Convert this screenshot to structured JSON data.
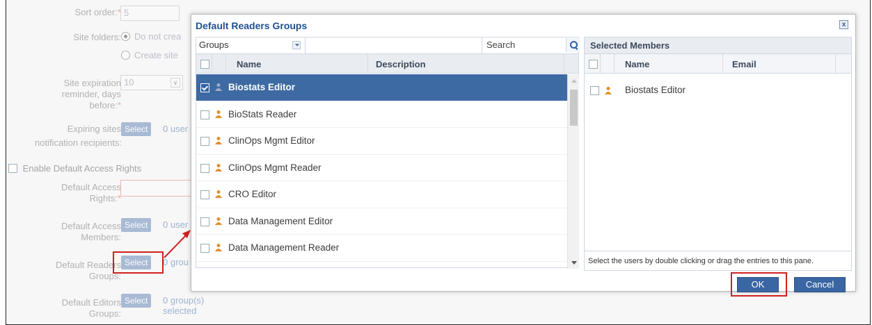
{
  "form": {
    "sort_order_label": "Sort order:",
    "sort_order_value": "5",
    "site_folders_label": "Site folders:",
    "site_folders_opt1": "Do not crea",
    "site_folders_opt2": "Create site",
    "expiration_label_1": "Site expiration",
    "expiration_label_2": "reminder, days",
    "expiration_label_3": "before:",
    "expiration_value": "10",
    "expiring_label_1": "Expiring sites",
    "expiring_label_2": "notification recipients:",
    "expiring_link": "0 user",
    "enable_default_access": "Enable Default Access Rights",
    "default_access_rights_1": "Default Access",
    "default_access_rights_2": "Rights:",
    "default_access_members_1": "Default Access",
    "default_access_members_2": "Members:",
    "default_access_members_link": "0 user",
    "default_readers_1": "Default Readers",
    "default_readers_2": "Groups:",
    "default_readers_link": "0 grou",
    "default_editors_1": "Default Editors",
    "default_editors_2": "Groups:",
    "default_editors_link": "0 group(s) selected",
    "select_label": "Select",
    "required_mark": "*"
  },
  "dialog": {
    "title": "Default Readers Groups",
    "close_glyph": "x",
    "type_combo": "Groups",
    "search_placeholder": "Search",
    "columns": {
      "name": "Name",
      "description": "Description"
    },
    "rows": [
      {
        "name": "Biostats Editor",
        "checked": true
      },
      {
        "name": "BioStats Reader",
        "checked": false
      },
      {
        "name": "ClinOps Mgmt Editor",
        "checked": false
      },
      {
        "name": "ClinOps Mgmt Reader",
        "checked": false
      },
      {
        "name": "CRO Editor",
        "checked": false
      },
      {
        "name": "Data Management Editor",
        "checked": false
      },
      {
        "name": "Data Management Reader",
        "checked": false
      }
    ],
    "selected_members": {
      "title": "Selected Members",
      "columns": {
        "name": "Name",
        "email": "Email"
      },
      "items": [
        {
          "name": "Biostats Editor"
        }
      ],
      "hint": "Select the users by double clicking or drag the entries to this pane."
    },
    "ok_label": "OK",
    "cancel_label": "Cancel"
  },
  "colors": {
    "accent": "#3e6aa3",
    "title": "#1f4f91",
    "highlight_red": "#d21f1f",
    "group_icon": "#e0902a"
  }
}
